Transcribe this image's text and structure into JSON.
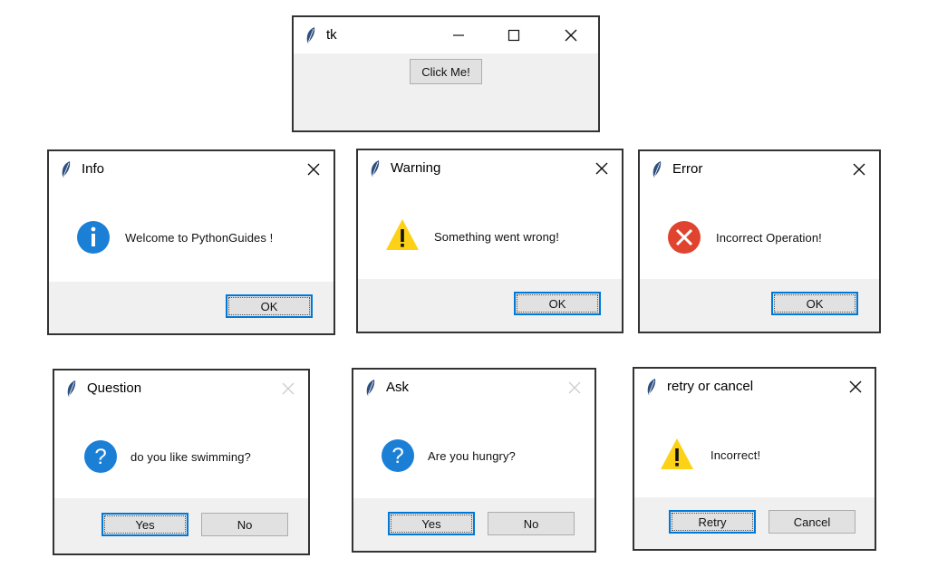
{
  "main_window": {
    "title": "tk",
    "button_label": "Click Me!"
  },
  "dialogs": {
    "info": {
      "title": "Info",
      "message": "Welcome to PythonGuides !",
      "icon": "info-icon",
      "ok_label": "OK"
    },
    "warning": {
      "title": "Warning",
      "message": "Something went wrong!",
      "icon": "warning-icon",
      "ok_label": "OK"
    },
    "error": {
      "title": "Error",
      "message": "Incorrect Operation!",
      "icon": "error-icon",
      "ok_label": "OK"
    },
    "question": {
      "title": "Question",
      "message": "do you like swimming?",
      "icon": "question-icon",
      "yes_label": "Yes",
      "no_label": "No"
    },
    "ask": {
      "title": "Ask",
      "message": "Are you hungry?",
      "icon": "question-icon",
      "yes_label": "Yes",
      "no_label": "No"
    },
    "retry": {
      "title": "retry or cancel",
      "message": "Incorrect!",
      "icon": "warning-icon",
      "retry_label": "Retry",
      "cancel_label": "Cancel"
    }
  },
  "colors": {
    "info_blue": "#1b7fd6",
    "warning_yellow": "#fcd116",
    "error_red": "#e0442f",
    "default_button_border": "#0078d7"
  }
}
